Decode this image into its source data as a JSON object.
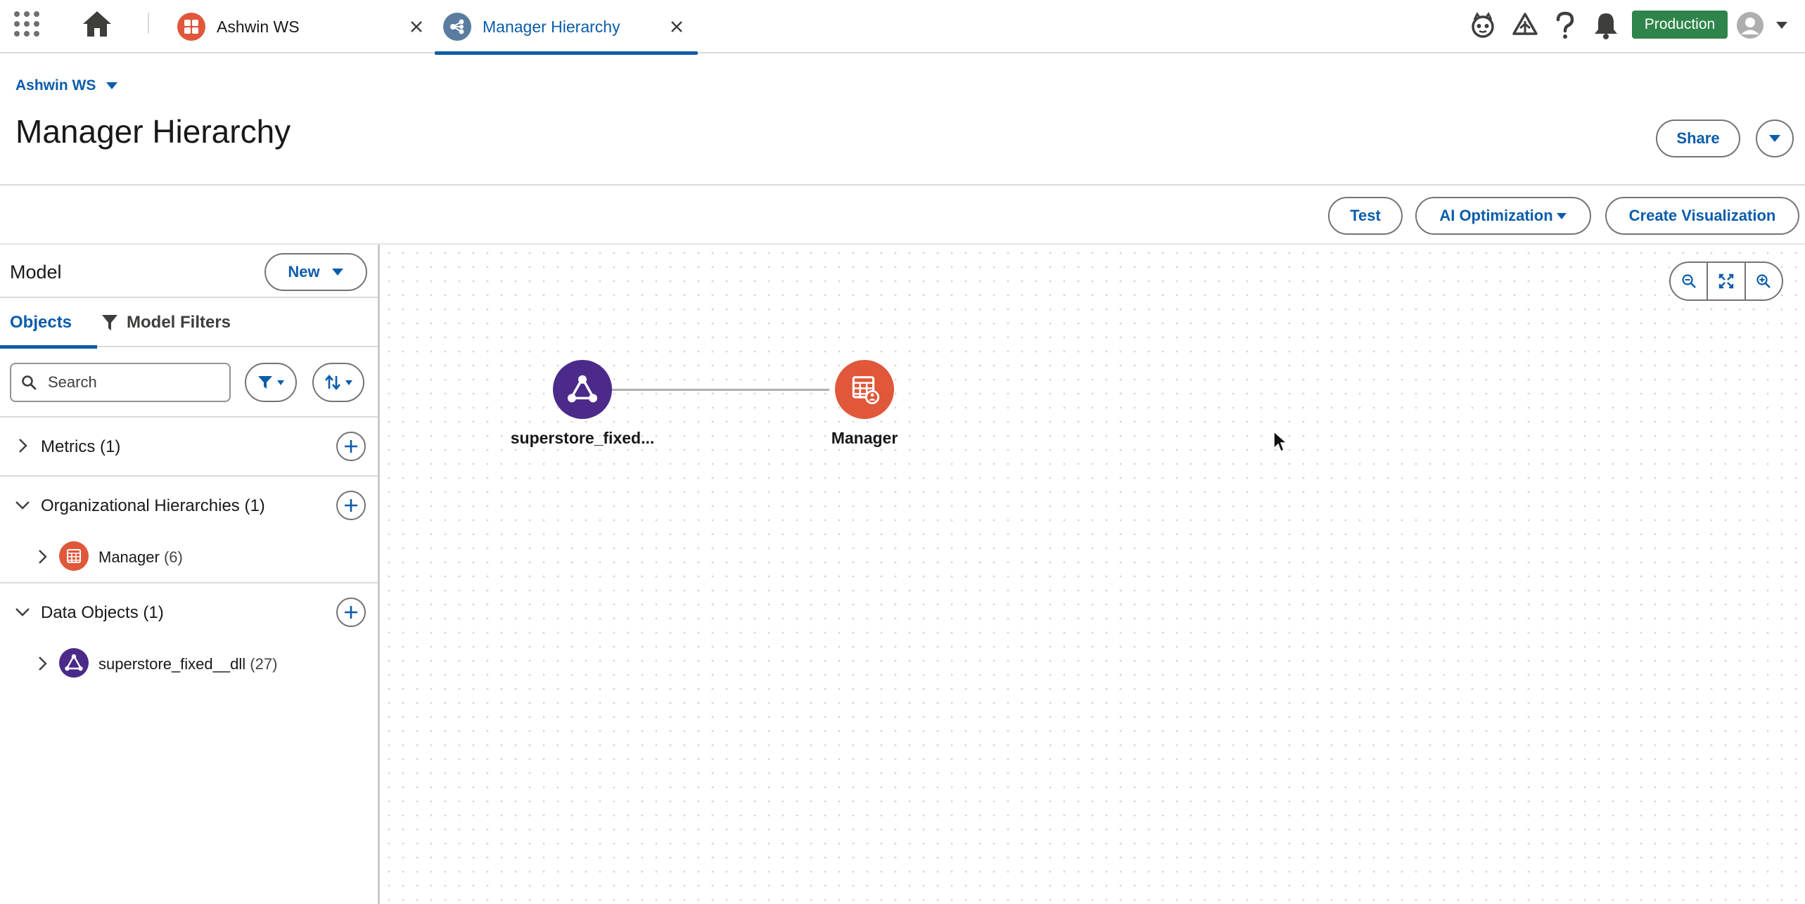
{
  "tabs": [
    {
      "label": "Ashwin WS",
      "icon": "workspace-icon",
      "active": false
    },
    {
      "label": "Manager Hierarchy",
      "icon": "semantic-model-icon",
      "active": true
    }
  ],
  "utility": {
    "environment_badge": "Production"
  },
  "header": {
    "workspace": "Ashwin WS",
    "title": "Manager Hierarchy",
    "share_label": "Share"
  },
  "toolbar": {
    "test_label": "Test",
    "ai_optimization_label": "AI Optimization",
    "create_visualization_label": "Create Visualization"
  },
  "model_panel": {
    "title": "Model",
    "new_label": "New",
    "tabs": {
      "objects": "Objects",
      "model_filters": "Model Filters"
    },
    "search": {
      "placeholder": "Search",
      "value": ""
    },
    "sections": {
      "metrics": {
        "label": "Metrics (1)",
        "expanded": false
      },
      "org_hierarchies": {
        "label": "Organizational Hierarchies (1)",
        "expanded": true,
        "items": [
          {
            "label": "Manager",
            "count": "(6)"
          }
        ]
      },
      "data_objects": {
        "label": "Data Objects (1)",
        "expanded": true,
        "items": [
          {
            "label": "superstore_fixed__dll",
            "count": "(27)"
          }
        ]
      }
    }
  },
  "canvas": {
    "nodes": [
      {
        "label": "superstore_fixed...",
        "icon": "data-object-icon",
        "color": "#4b2a8a"
      },
      {
        "label": "Manager",
        "icon": "hierarchy-table-icon",
        "color": "#e0573a"
      }
    ]
  },
  "colors": {
    "brand_blue": "#0b5cab",
    "production_green": "#2e844a",
    "data_object_purple": "#4b2a8a",
    "hierarchy_orange": "#e0573a"
  }
}
